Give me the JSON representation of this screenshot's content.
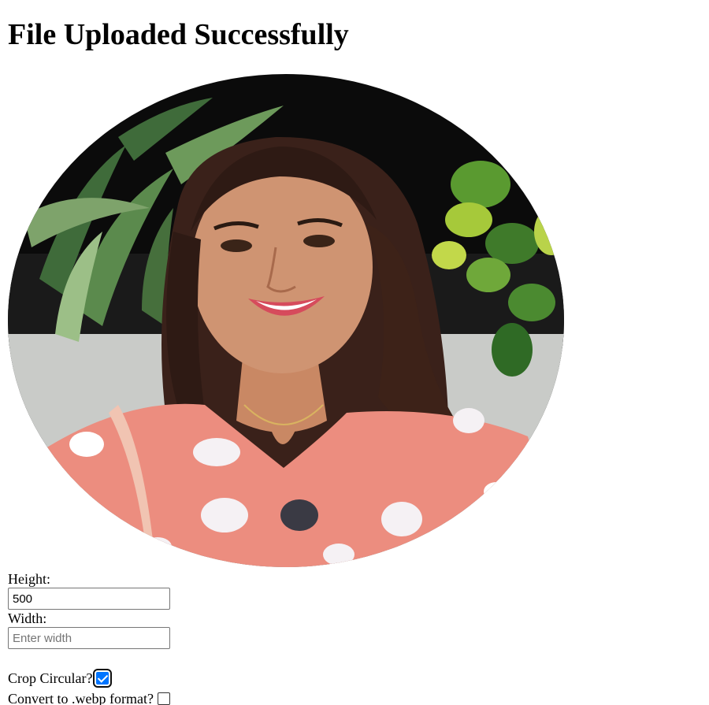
{
  "page": {
    "heading": "File Uploaded Successfully"
  },
  "image": {
    "alt": "Uploaded photo cropped circular: smiling woman in coral floral top in front of plants"
  },
  "form": {
    "height_label": "Height:",
    "height_value": "500",
    "width_label": "Width:",
    "width_value": "",
    "width_placeholder": "Enter width",
    "crop_label": "Crop Circular?",
    "crop_checked": true,
    "webp_label": "Convert to .webp format?",
    "webp_checked": false
  },
  "colors": {
    "checkbox_accent": "#0075ff"
  }
}
